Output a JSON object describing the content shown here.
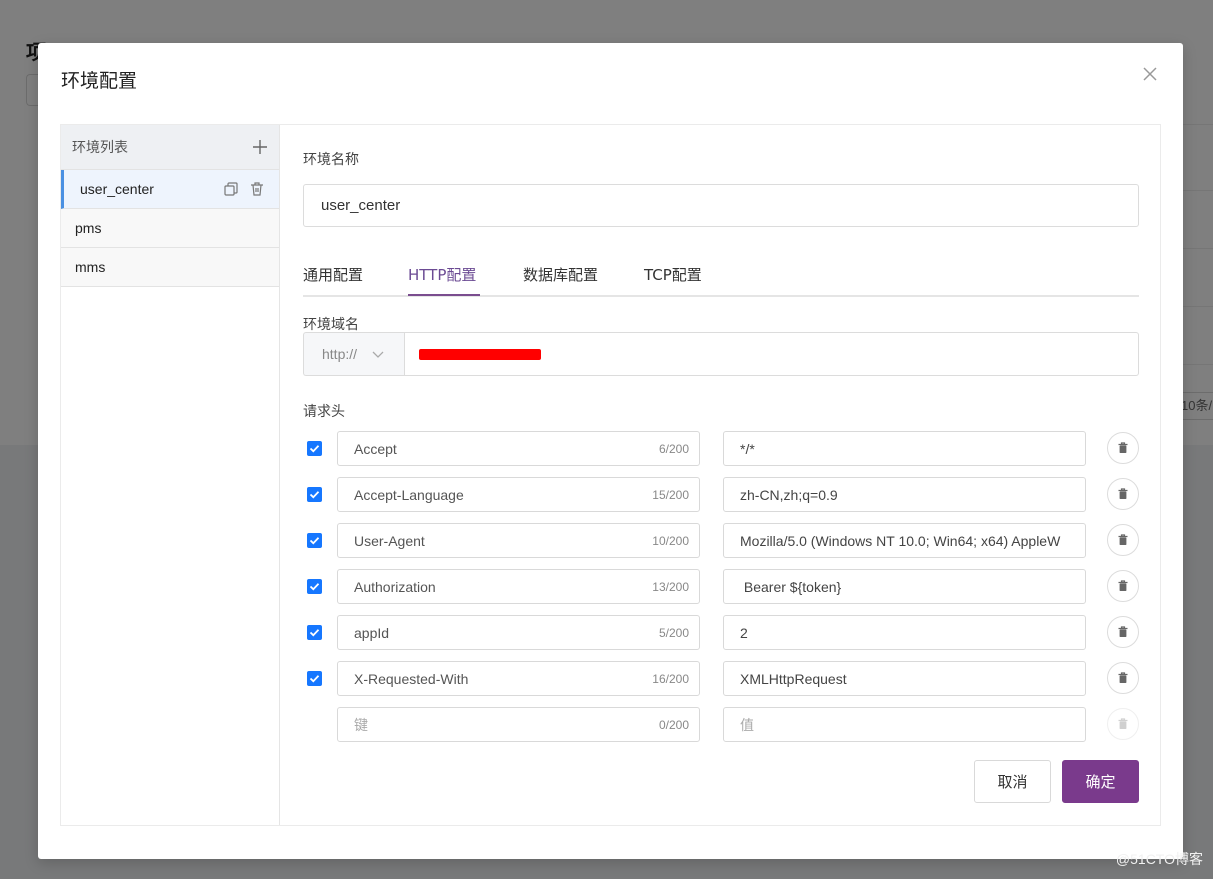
{
  "background": {
    "page_title": "项目",
    "pager_text": "10条/"
  },
  "modal": {
    "title": "环境配置",
    "close_icon": "close-icon"
  },
  "sidebar": {
    "title": "环境列表",
    "add_icon": "plus-icon",
    "items": [
      {
        "label": "user_center",
        "active": true
      },
      {
        "label": "pms",
        "active": false
      },
      {
        "label": "mms",
        "active": false
      }
    ]
  },
  "form": {
    "env_name_label": "环境名称",
    "env_name_value": "user_center",
    "tabs": [
      {
        "label": "通用配置",
        "active": false
      },
      {
        "label": "HTTP配置",
        "active": true
      },
      {
        "label": "数据库配置",
        "active": false
      },
      {
        "label": "TCP配置",
        "active": false
      }
    ],
    "domain_label": "环境域名",
    "protocol": "http://",
    "domain_redacted": true,
    "headers_label": "请求头",
    "headers": [
      {
        "checked": true,
        "key": "Accept",
        "count": "6/200",
        "value": "*/*"
      },
      {
        "checked": true,
        "key": "Accept-Language",
        "count": "15/200",
        "value": "zh-CN,zh;q=0.9"
      },
      {
        "checked": true,
        "key": "User-Agent",
        "count": "10/200",
        "value": "Mozilla/5.0 (Windows NT 10.0; Win64; x64) AppleW"
      },
      {
        "checked": true,
        "key": "Authorization",
        "count": "13/200",
        "value": " Bearer ${token}"
      },
      {
        "checked": true,
        "key": "appId",
        "count": "5/200",
        "value": "2"
      },
      {
        "checked": true,
        "key": "X-Requested-With",
        "count": "16/200",
        "value": "XMLHttpRequest"
      }
    ],
    "new_header": {
      "key_placeholder": "键",
      "count": "0/200",
      "value_placeholder": "值"
    },
    "cancel_label": "取消",
    "ok_label": "确定"
  },
  "colors": {
    "primary": "#7a3a8c",
    "tab_active": "#6b4a93",
    "checkbox": "#1677ff",
    "active_item_border": "#4a90e2",
    "redaction": "#ff0000"
  },
  "watermark": "@51CTO博客"
}
